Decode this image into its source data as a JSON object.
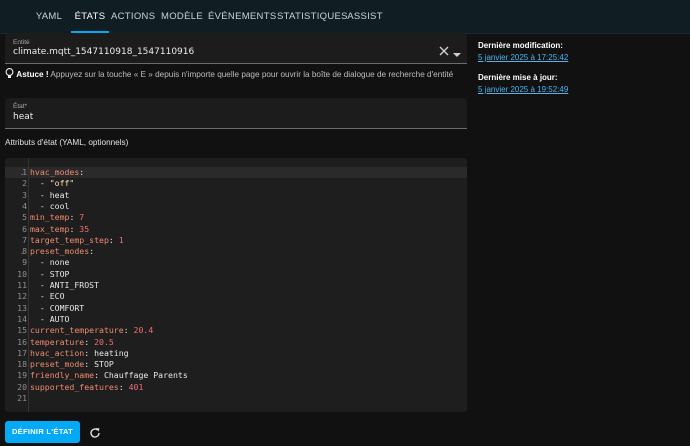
{
  "tabs": [
    "YAML",
    "ÉTATS",
    "ACTIONS",
    "MODÈLE",
    "ÉVÉNEMENTS",
    "STATISTIQUES",
    "ASSIST"
  ],
  "active_tab": "ÉTATS",
  "entity_field": {
    "label": "Entité",
    "value": "climate.mqtt_1547110918_1547110916"
  },
  "tip": {
    "strong": "Astuce !",
    "text": "Appuyez sur la touche « E » depuis n'importe quelle page pour ouvrir la boîte de dialogue de recherche d'entité"
  },
  "state_field": {
    "label": "État*",
    "value": "heat"
  },
  "attributes_label": "Attributs d'état (YAML, optionnels)",
  "code_lines": [
    "hvac_modes:",
    "  - \"off\"",
    "  - heat",
    "  - cool",
    "min_temp: 7",
    "max_temp: 35",
    "target_temp_step: 1",
    "preset_modes:",
    "  - none",
    "  - STOP",
    "  - ANTI_FROST",
    "  - ECO",
    "  - COMFORT",
    "  - AUTO",
    "current_temperature: 20.4",
    "temperature: 20.5",
    "hvac_action: heating",
    "preset_mode: STOP",
    "friendly_name: Chauffage Parents",
    "supported_features: 401",
    ""
  ],
  "side": {
    "last_changed_label": "Dernière modification:",
    "last_changed_value": "5 janvier 2025 à 17:25:42",
    "last_updated_label": "Dernière mise à jour:",
    "last_updated_value": "5 janvier 2025 à 19:52:49"
  },
  "set_state_button": "DÉFINIR L'ÉTAT",
  "icons": [
    "clear-icon",
    "dropdown-arrow-icon",
    "lightbulb-icon",
    "refresh-icon",
    "fold-arrow-icon"
  ]
}
